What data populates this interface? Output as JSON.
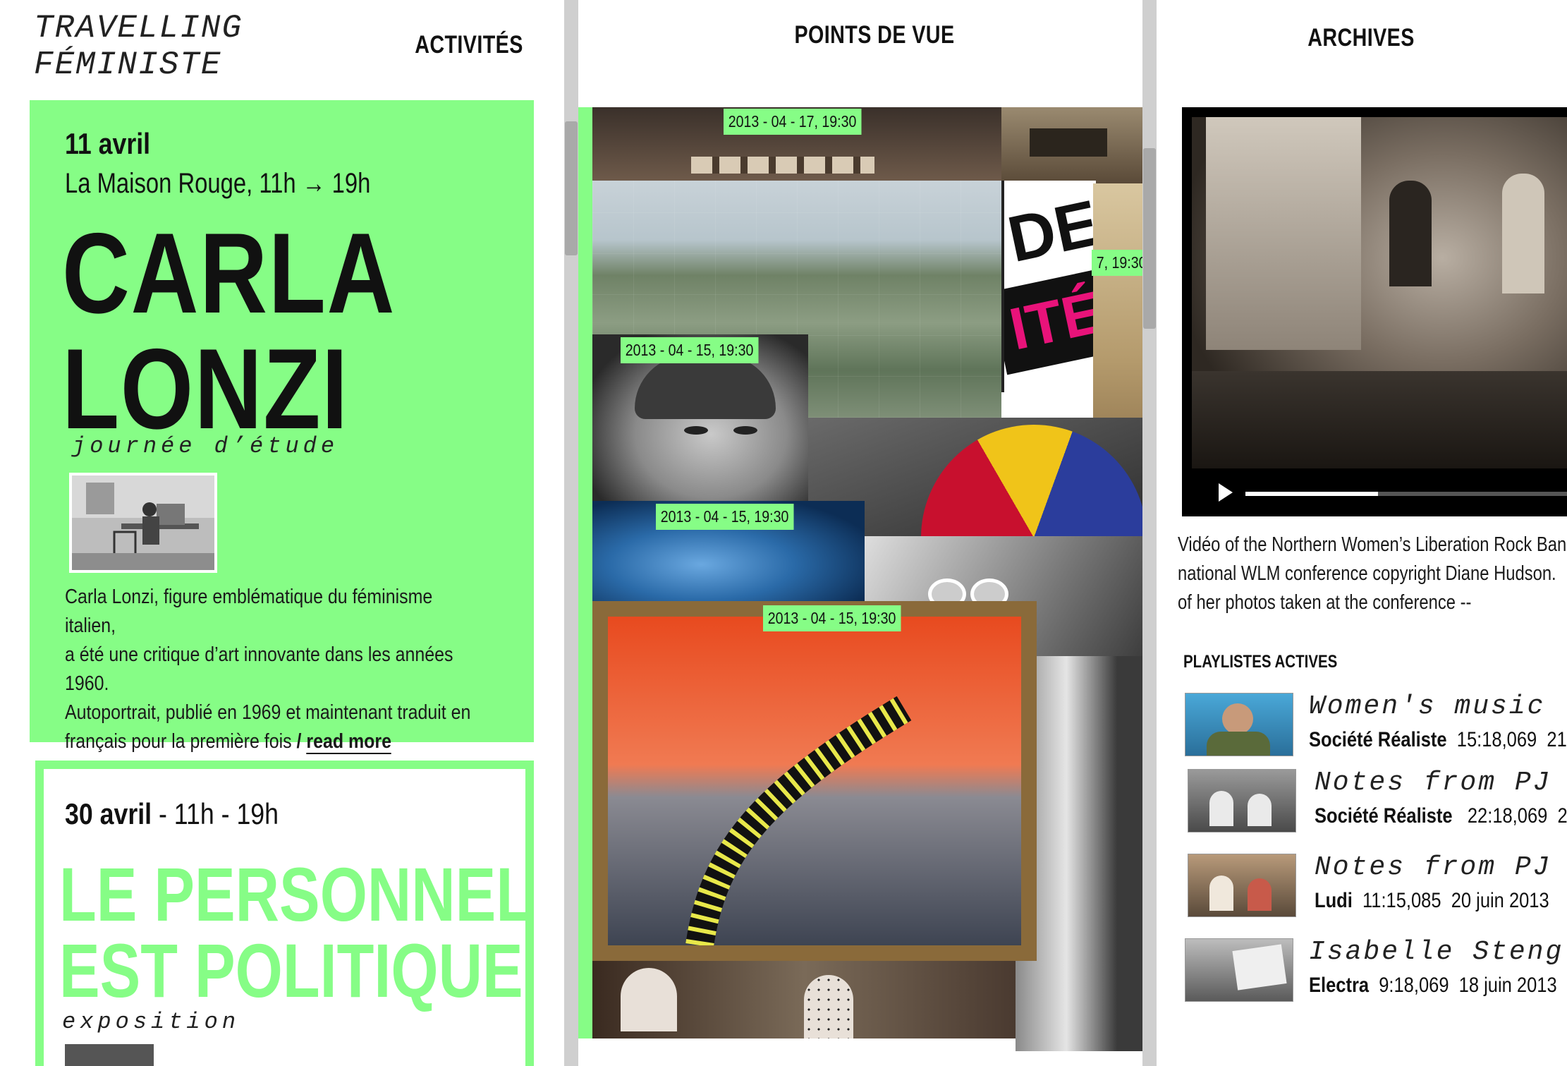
{
  "site": {
    "title_line1": "TRAVELLING",
    "title_line2": "FÉMINISTE"
  },
  "nav": {
    "activites": "ACTIVITÉS",
    "points_de_vue": "POINTS DE VUE",
    "archives": "ARCHIVES"
  },
  "events": [
    {
      "date": "11 avril",
      "venue": "La Maison Rouge, 11h → 19h",
      "title_line1": "CARLA",
      "title_line2": "LONZI",
      "kind": "journée d’étude",
      "description_lines": [
        "Carla Lonzi, figure emblématique du féminisme italien,",
        "a été une critique d’art innovante dans les années 1960.",
        "Autoportrait, publié en 1969 et maintenant traduit en",
        "français pour la première fois"
      ],
      "read_more_sep": " / ",
      "read_more": "read more"
    },
    {
      "date": "30 avril",
      "time": " - 11h - 19h",
      "title_line1": "LE PERSONNEL",
      "title_line2": "EST POLITIQUE",
      "kind": "exposition"
    }
  ],
  "points_de_vue": {
    "stamps": [
      "2013 - 04 - 17, 19:30",
      "7, 19:30",
      "2013 - 04 - 15, 19:30",
      "2013 - 04 - 15, 19:30",
      "2013 - 04 - 15, 19:30"
    ],
    "poster_text": {
      "word_1": "DE",
      "word_2": "ITÉ"
    }
  },
  "archives": {
    "caption_lines": [
      "Vidéo of the Northern Women’s Liberation Rock Band",
      "national WLM conference copyright Diane Hudson.",
      "of her photos taken at the conference --"
    ],
    "playlists_heading": "PLAYLISTES ACTIVES",
    "playlists": [
      {
        "title": "Women's music l",
        "author": "Société Réaliste",
        "duration": "15:18,069",
        "date": "21"
      },
      {
        "title": "Notes from PJ",
        "author": "Société Réaliste",
        "duration": "22:18,069",
        "date": "2"
      },
      {
        "title": "Notes from PJ",
        "author": "Ludi",
        "duration": "11:15,085",
        "date": "20 juin 2013"
      },
      {
        "title": "Isabelle Steng",
        "author": "Electra",
        "duration": "9:18,069",
        "date": "18 juin 2013"
      }
    ]
  },
  "colors": {
    "accent": "#86fd86",
    "text": "#111111",
    "separator": "#cfcfcf"
  }
}
